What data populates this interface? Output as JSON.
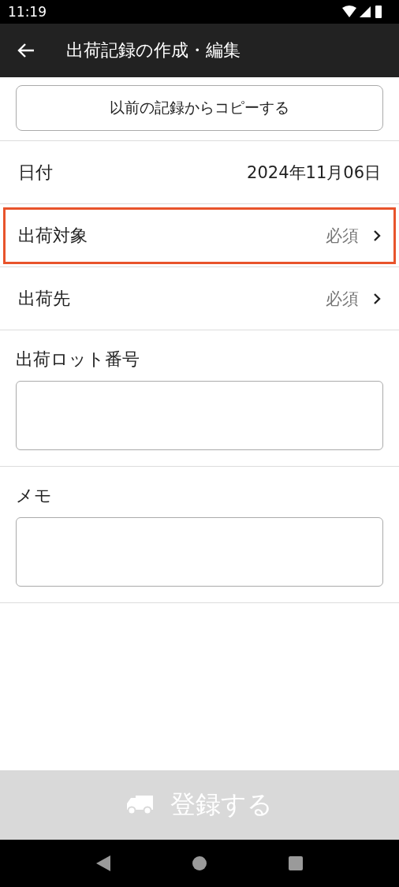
{
  "status_bar": {
    "time": "11:19"
  },
  "app_bar": {
    "title": "出荷記録の作成・編集"
  },
  "copy_button": {
    "label": "以前の記録からコピーする"
  },
  "form": [
    {
      "kind": "value",
      "label": "日付",
      "value": "2024年11月06日",
      "highlighted": false
    },
    {
      "kind": "select",
      "label": "出荷対象",
      "value": "必須",
      "highlighted": true
    },
    {
      "kind": "select",
      "label": "出荷先",
      "value": "必須",
      "highlighted": false
    },
    {
      "kind": "textarea",
      "label": "出荷ロット番号"
    },
    {
      "kind": "textarea",
      "label": "メモ"
    }
  ],
  "submit_button": {
    "label": "登録する",
    "disabled": true
  }
}
